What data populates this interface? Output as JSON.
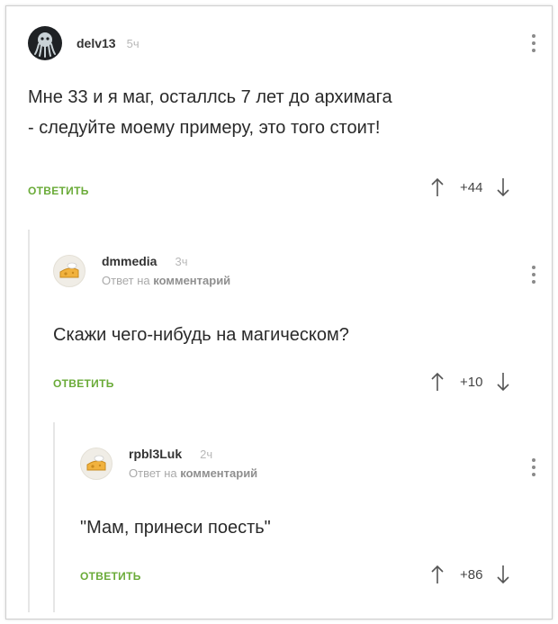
{
  "comments": [
    {
      "username": "delv13",
      "time": "5ч",
      "text_lines": [
        "Мне 33 и я маг, осталлсь 7 лет до архимага",
        "- следуйте моему примеру, это того стоит!"
      ],
      "reply_label": "ОТВЕТИТЬ",
      "score": "+44"
    },
    {
      "username": "dmmedia",
      "time": "3ч",
      "reply_prefix": "Ответ на",
      "reply_target": "комментарий",
      "text_lines": [
        "Скажи чего-нибудь на магическом?"
      ],
      "reply_label": "ОТВЕТИТЬ",
      "score": "+10"
    },
    {
      "username": "rpbl3Luk",
      "time": "2ч",
      "reply_prefix": "Ответ на",
      "reply_target": "комментарий",
      "text_lines": [
        "\"Мам, принеси поесть\""
      ],
      "reply_label": "ОТВЕТИТЬ",
      "score": "+86"
    }
  ],
  "icons": {
    "menu": "vertical-ellipsis-icon",
    "upvote": "arrow-up-icon",
    "downvote": "arrow-down-icon"
  },
  "colors": {
    "reply_button": "#6aab38",
    "thread_line": "#e6e6e6"
  }
}
